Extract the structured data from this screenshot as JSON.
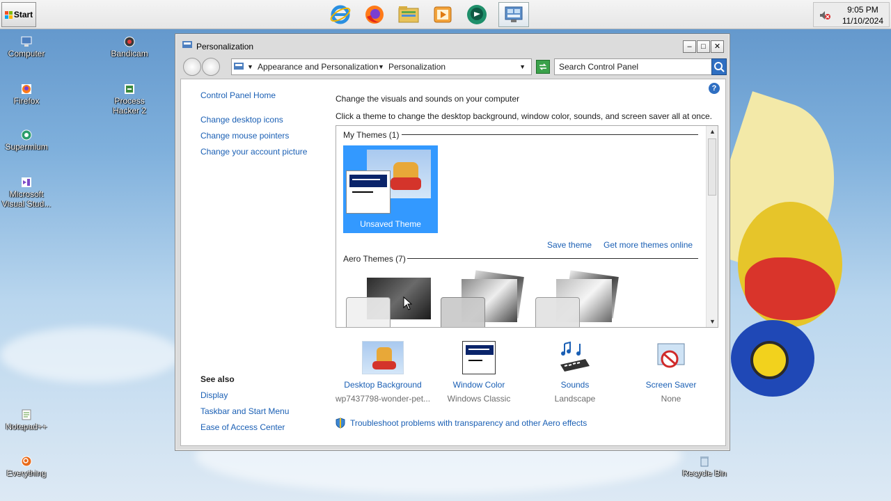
{
  "taskbar": {
    "start_label": "Start",
    "apps": [
      "internet-explorer-icon",
      "firefox-icon",
      "file-explorer-icon",
      "media-player-icon",
      "chat-app-icon",
      "control-panel-icon"
    ],
    "clock_time": "9:05 PM",
    "clock_date": "11/10/2024"
  },
  "desktop": {
    "icons": [
      {
        "label": "Computer"
      },
      {
        "label": "Bandicam"
      },
      {
        "label": "Firefox"
      },
      {
        "label": "Process Hacker 2"
      },
      {
        "label": "Supermium"
      },
      {
        "label": "Microsoft Visual Stud..."
      },
      {
        "label": "Notepad++"
      },
      {
        "label": "Everything"
      },
      {
        "label": "Recycle Bin"
      }
    ]
  },
  "window": {
    "title": "Personalization",
    "breadcrumb": [
      "Appearance and Personalization",
      "Personalization"
    ],
    "search_placeholder": "Search Control Panel",
    "sidebar": {
      "home": "Control Panel Home",
      "links": [
        "Change desktop icons",
        "Change mouse pointers",
        "Change your account picture"
      ],
      "see_also_title": "See also",
      "see_also": [
        "Display",
        "Taskbar and Start Menu",
        "Ease of Access Center"
      ]
    },
    "main": {
      "heading": "Change the visuals and sounds on your computer",
      "description": "Click a theme to change the desktop background, window color, sounds, and screen saver all at once.",
      "my_themes_title": "My Themes (1)",
      "unsaved_theme": "Unsaved Theme",
      "save_theme": "Save theme",
      "get_more": "Get more themes online",
      "aero_themes_title": "Aero Themes (7)",
      "bottom": [
        {
          "label": "Desktop Background",
          "value": "wp7437798-wonder-pet..."
        },
        {
          "label": "Window Color",
          "value": "Windows Classic"
        },
        {
          "label": "Sounds",
          "value": "Landscape"
        },
        {
          "label": "Screen Saver",
          "value": "None"
        }
      ],
      "troubleshoot": "Troubleshoot problems with transparency and other Aero effects"
    }
  },
  "colors": {
    "link": "#1a5fb4",
    "selection": "#3399ff",
    "wallpaper_sky": "#7fb0dc"
  }
}
